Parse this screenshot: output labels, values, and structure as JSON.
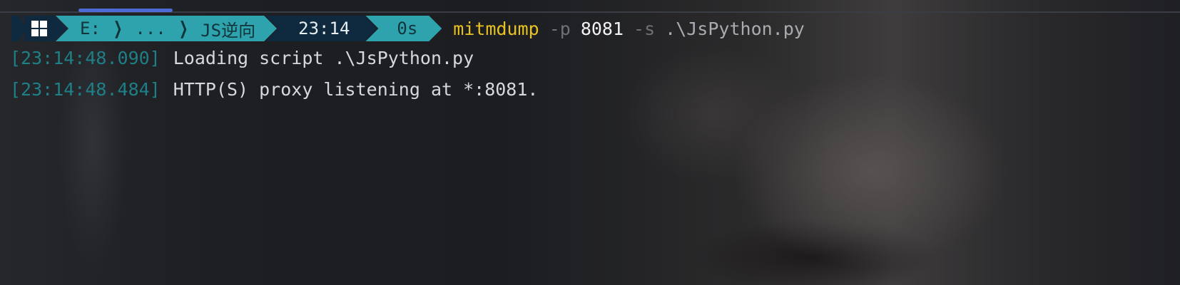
{
  "prompt": {
    "os_icon": "windows-icon",
    "path_segments": [
      "E:",
      "...",
      "JS逆向"
    ],
    "time": "23:14",
    "exec_time": "0s",
    "colors": {
      "segment_dark": "#0f2a3f",
      "segment_teal": "#2fa3ad",
      "command": "#e8c21f",
      "timestamp": "#1f7f87",
      "tab_indicator": "#4d6ad6"
    }
  },
  "command": {
    "name": "mitmdump",
    "flag_port": "-p",
    "port": "8081",
    "flag_script": "-s",
    "script": ".\\JsPython.py"
  },
  "log": [
    {
      "timestamp": "[23:14:48.090]",
      "message": "Loading script .\\JsPython.py"
    },
    {
      "timestamp": "[23:14:48.484]",
      "message": "HTTP(S) proxy listening at *:8081."
    }
  ]
}
